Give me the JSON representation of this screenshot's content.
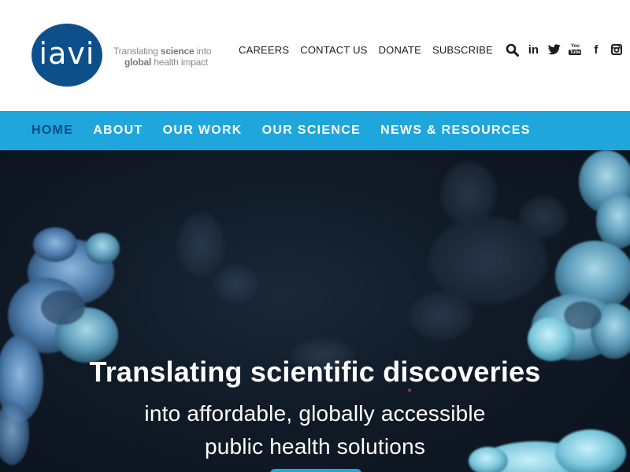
{
  "brand": {
    "logo_text": "iavi",
    "tagline_line1_pre": "Translating ",
    "tagline_line1_bold": "science",
    "tagline_line1_post": " into",
    "tagline_line2_bold": "global",
    "tagline_line2_post": " health impact",
    "color_primary": "#0d4f8b",
    "color_accent": "#1fa6dc"
  },
  "utility_nav": {
    "careers": "CAREERS",
    "contact": "CONTACT US",
    "donate": "DONATE",
    "subscribe": "SUBSCRIBE",
    "icons": [
      "search-icon",
      "linkedin-icon",
      "twitter-icon",
      "youtube-icon",
      "facebook-icon",
      "instagram-icon"
    ],
    "linkedin_text": "in",
    "facebook_text": "f",
    "youtube_top": "You",
    "youtube_bottom": "Tube"
  },
  "main_nav": {
    "items": [
      {
        "label": "HOME",
        "active": true
      },
      {
        "label": "ABOUT",
        "active": false
      },
      {
        "label": "OUR WORK",
        "active": false
      },
      {
        "label": "OUR SCIENCE",
        "active": false
      },
      {
        "label": "NEWS & RESOURCES",
        "active": false
      }
    ]
  },
  "hero": {
    "title": "Translating scientific discoveries",
    "subtitle": "into affordable, globally accessible public health solutions"
  }
}
